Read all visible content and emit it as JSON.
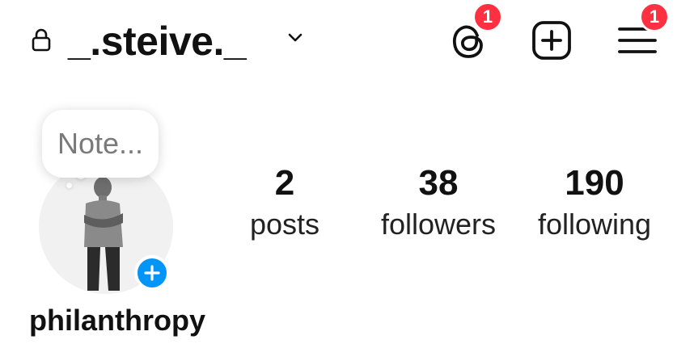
{
  "header": {
    "username": "_.steive._",
    "threads_badge": "1",
    "menu_badge": "1"
  },
  "note": {
    "placeholder": "Note..."
  },
  "stats": {
    "posts": {
      "value": "2",
      "label": "posts"
    },
    "followers": {
      "value": "38",
      "label": "followers"
    },
    "following": {
      "value": "190",
      "label": "following"
    }
  },
  "profile": {
    "display_name": "philanthropy"
  },
  "colors": {
    "badge": "#ff3040",
    "add_story": "#0095f6",
    "text": "#111111"
  },
  "icons": [
    "lock-icon",
    "chevron-down-icon",
    "threads-icon",
    "create-icon",
    "menu-icon",
    "add-story-icon"
  ]
}
